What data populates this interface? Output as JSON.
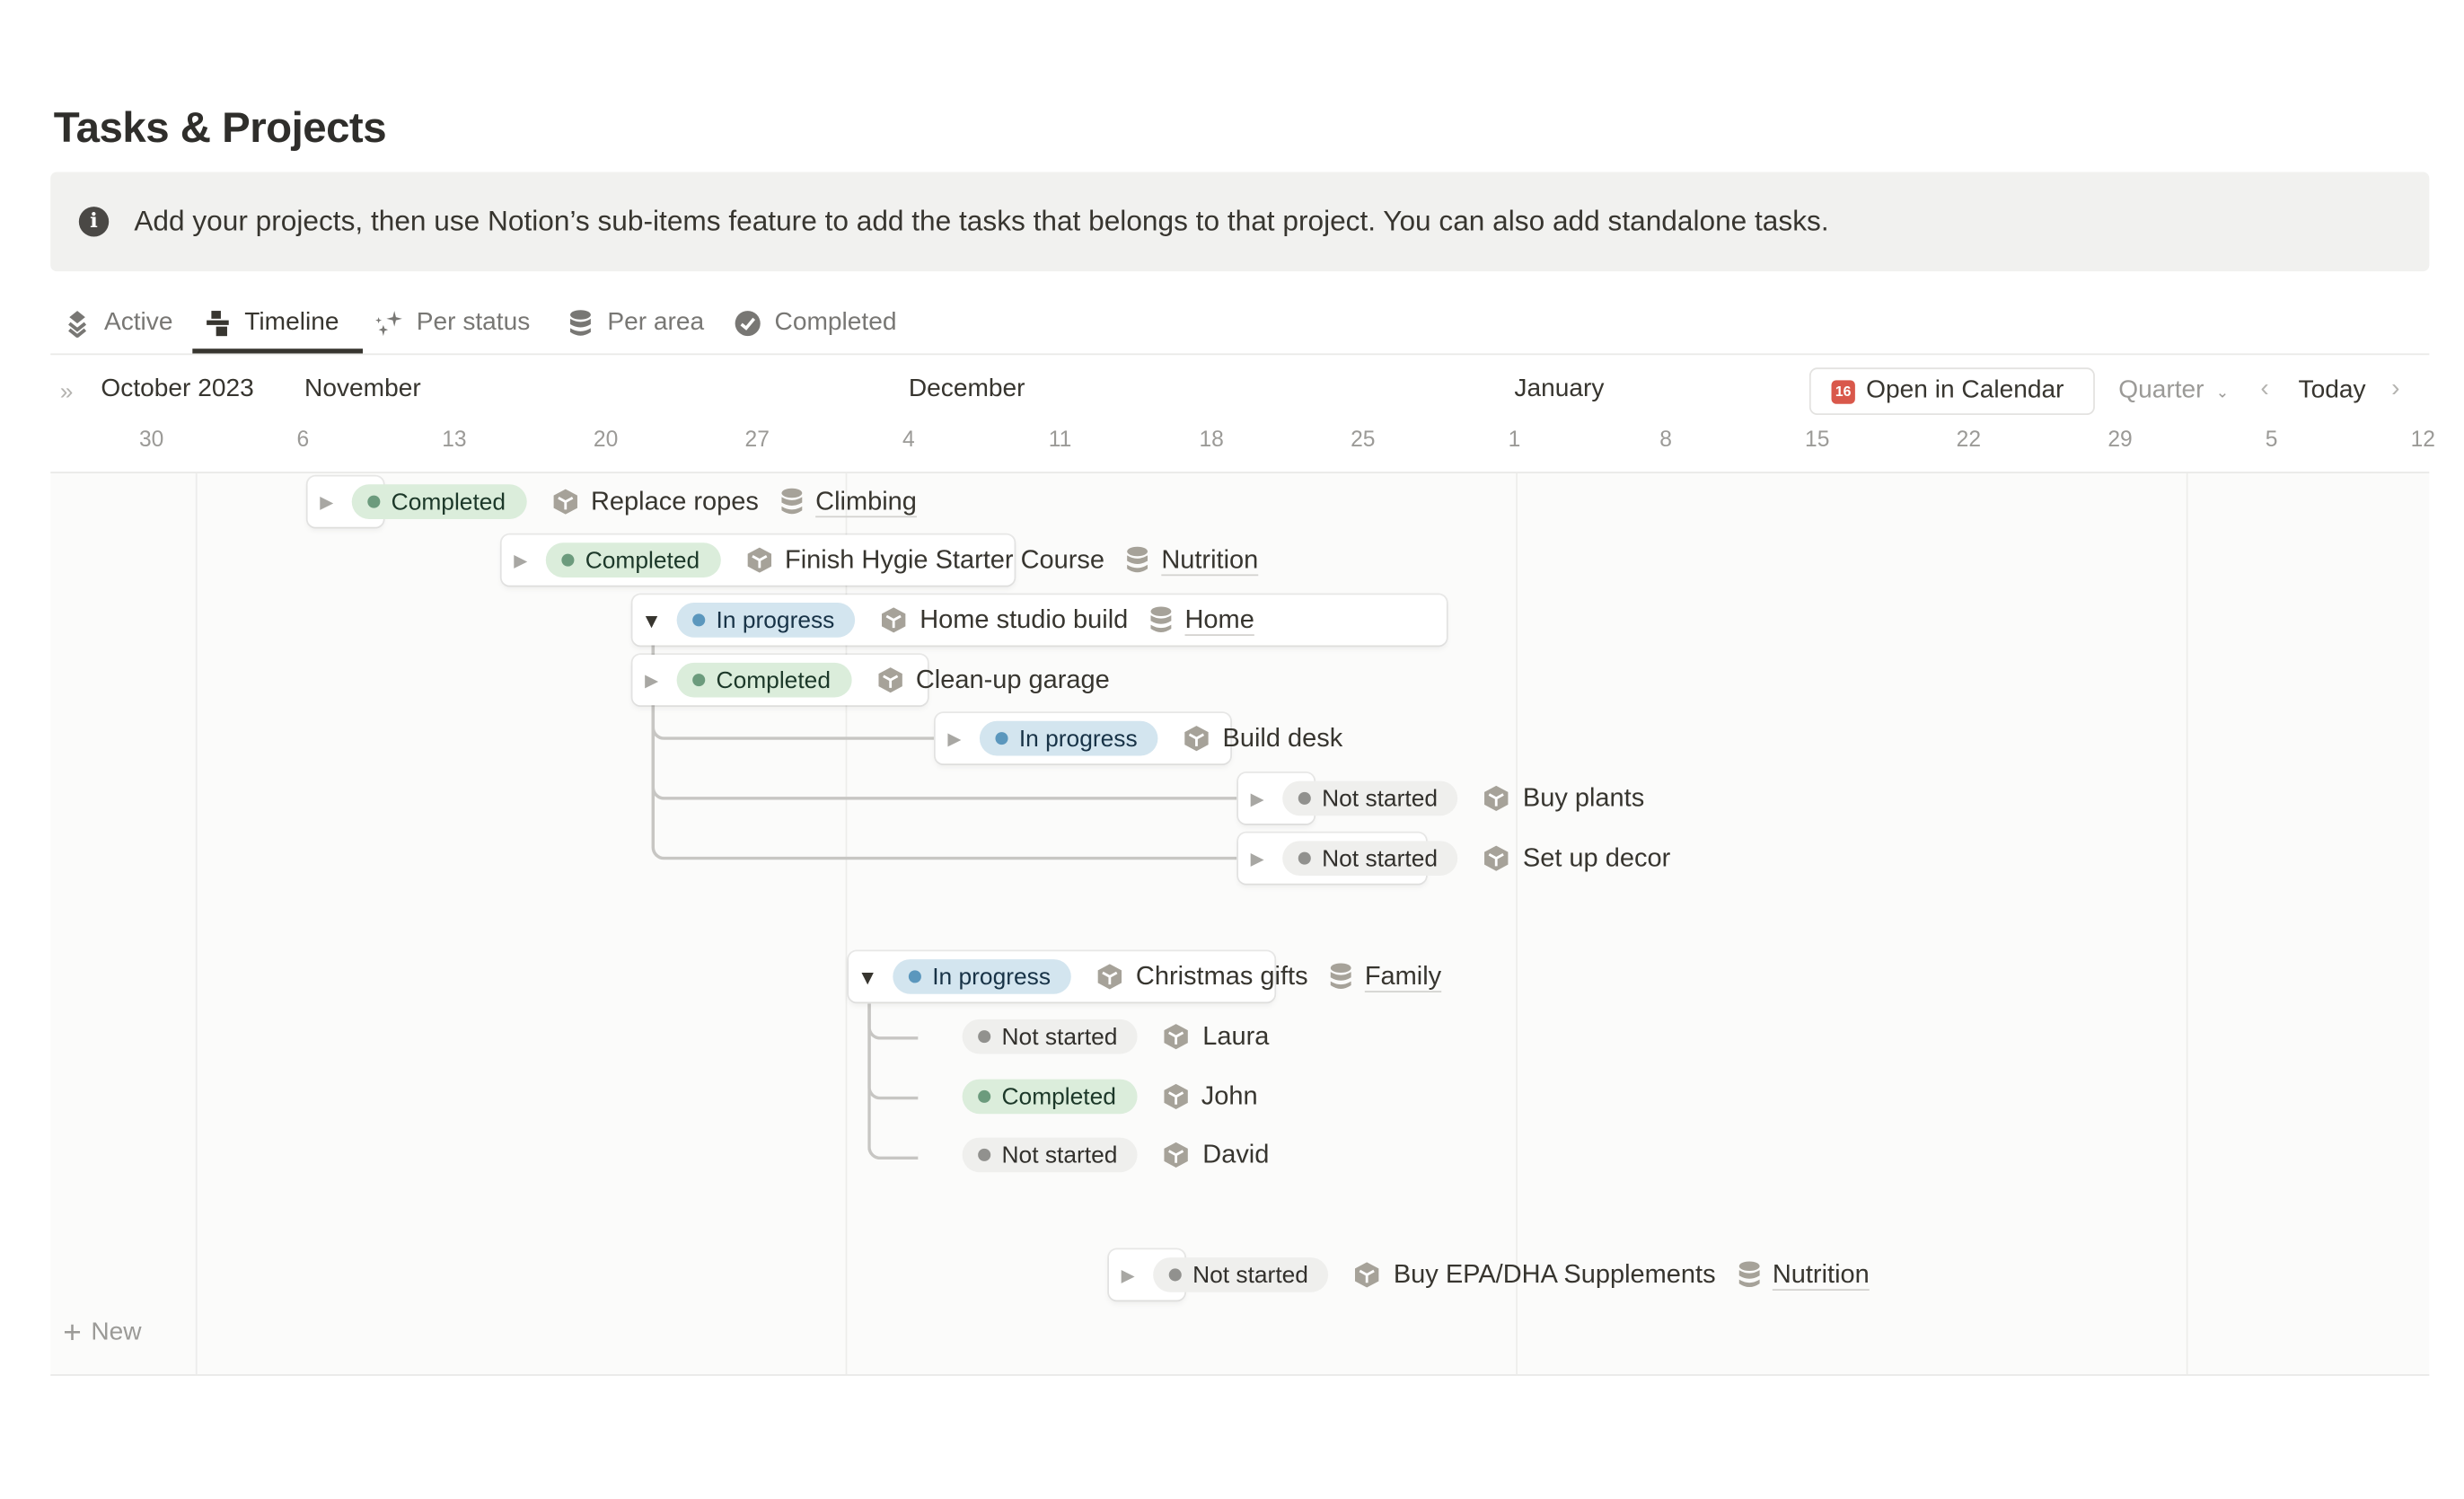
{
  "page": {
    "title": "Tasks & Projects",
    "callout": {
      "icon": "info-icon",
      "text": "Add your projects, then use Notion’s sub-items feature to add the tasks that belongs to that project. You can also add standalone tasks."
    }
  },
  "tabs": [
    {
      "label": "Active",
      "icon": "layers-icon",
      "active": false
    },
    {
      "label": "Timeline",
      "icon": "timeline-icon",
      "active": true
    },
    {
      "label": "Per status",
      "icon": "sparkle-icon",
      "active": false
    },
    {
      "label": "Per area",
      "icon": "database-icon",
      "active": false
    },
    {
      "label": "Completed",
      "icon": "check-circle-icon",
      "active": false
    }
  ],
  "timeline": {
    "months": [
      "October 2023",
      "November",
      "December",
      "January"
    ],
    "weeks": [
      "30",
      "6",
      "13",
      "20",
      "27",
      "4",
      "11",
      "18",
      "25",
      "1",
      "8",
      "15",
      "22",
      "29",
      "5",
      "12"
    ],
    "open_in_calendar": "Open in Calendar",
    "calendar_icon_day": "16",
    "zoom_level": "Quarter",
    "today": "Today",
    "new_label": "New"
  },
  "items": [
    {
      "status": "Completed",
      "name": "Replace ropes",
      "area": "Climbing",
      "expanded": false
    },
    {
      "status": "Completed",
      "name": "Finish Hygie Starter Course",
      "area": "Nutrition",
      "expanded": false
    },
    {
      "status": "In progress",
      "name": "Home studio build",
      "area": "Home",
      "expanded": true
    },
    {
      "status": "Completed",
      "name": "Clean-up garage",
      "area": "",
      "expanded": false
    },
    {
      "status": "In progress",
      "name": "Build desk",
      "area": "",
      "expanded": false
    },
    {
      "status": "Not started",
      "name": "Buy plants",
      "area": "",
      "expanded": false
    },
    {
      "status": "Not started",
      "name": "Set up decor",
      "area": "",
      "expanded": false
    },
    {
      "status": "In progress",
      "name": "Christmas gifts",
      "area": "Family",
      "expanded": true
    },
    {
      "status": "Not started",
      "name": "Laura",
      "area": "",
      "expanded": false
    },
    {
      "status": "Completed",
      "name": "John",
      "area": "",
      "expanded": false
    },
    {
      "status": "Not started",
      "name": "David",
      "area": "",
      "expanded": false
    },
    {
      "status": "Not started",
      "name": "Buy EPA/DHA Supplements",
      "area": "Nutrition",
      "expanded": false
    }
  ],
  "colors": {
    "completed_bg": "#dbeddb",
    "in_progress_bg": "#d3e5ef",
    "not_started_bg": "#efefed",
    "calendar_red": "#d9584b"
  }
}
